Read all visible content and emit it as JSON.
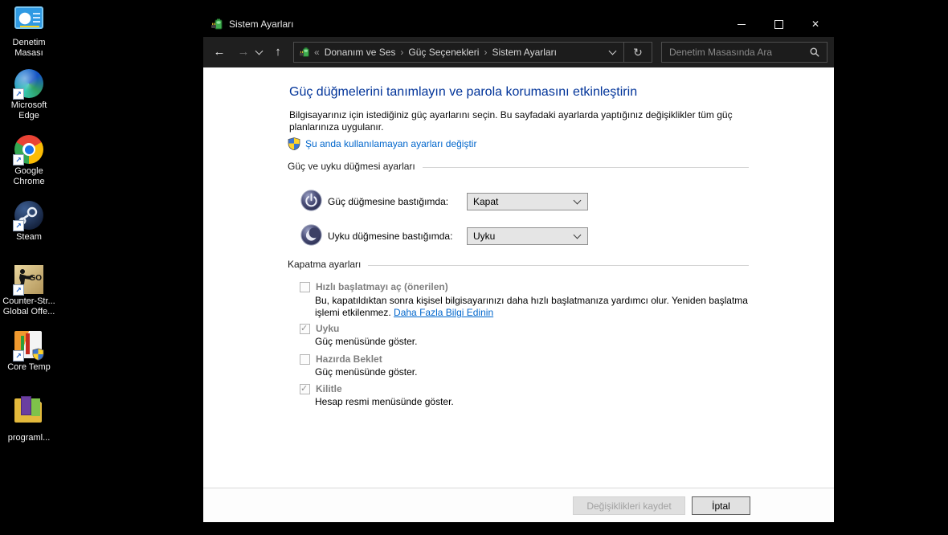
{
  "colors": {
    "heading_blue": "#003399",
    "link_blue": "#0066cc",
    "titlebar_bg": "#000000",
    "toolbar_bg": "#1f1f1f",
    "desktop_bg": "#000000"
  },
  "desktop": {
    "icons": [
      {
        "label": "Denetim Masası",
        "icon": "control-panel-icon"
      },
      {
        "label": "Microsoft Edge",
        "icon": "edge-icon"
      },
      {
        "label": "Google Chrome",
        "icon": "chrome-icon"
      },
      {
        "label": "Steam",
        "icon": "steam-icon"
      },
      {
        "label": "Counter-Str... Global Offe...",
        "icon": "csgo-icon",
        "icon_text": "GO"
      },
      {
        "label": "Core Temp",
        "icon": "core-temp-icon"
      },
      {
        "label": "programl...",
        "icon": "folder-icon"
      }
    ]
  },
  "titlebar": {
    "title": "Sistem Ayarları",
    "app_icon": "power-options-battery-icon",
    "close_glyph": "✕"
  },
  "toolbar": {
    "glyphs": {
      "back": "←",
      "forward": "→",
      "up": "↑",
      "refresh": "↻"
    },
    "breadcrumb": {
      "prefix": "«",
      "separator": "›",
      "items": [
        "Donanım ve Ses",
        "Güç Seçenekleri",
        "Sistem Ayarları"
      ]
    },
    "search": {
      "placeholder": "Denetim Masasında Ara",
      "icon": "magnifier-icon"
    }
  },
  "content": {
    "heading": "Güç düğmelerini tanımlayın ve parola korumasını etkinleştirin",
    "intro": "Bilgisayarınız için istediğiniz güç ayarlarını seçin. Bu sayfadaki ayarlarda yaptığınız değişiklikler tüm güç planlarınıza uygulanır.",
    "uac_link": "Şu anda kullanılamayan ayarları değiştir",
    "uac_icon": "uac-shield-icon",
    "power_section": {
      "title": "Güç ve uyku düğmesi ayarları",
      "rows": [
        {
          "icon": "power-button-icon",
          "label": "Güç düğmesine bastığımda:",
          "value": "Kapat"
        },
        {
          "icon": "sleep-button-icon",
          "label": "Uyku düğmesine bastığımda:",
          "value": "Uyku"
        }
      ]
    },
    "shutdown_section": {
      "title": "Kapatma ayarları",
      "items": [
        {
          "label": "Hızlı başlatmayı aç (önerilen)",
          "checked": false,
          "desc": "Bu, kapatıldıktan sonra kişisel bilgisayarınızı daha hızlı başlatmanıza yardımcı olur. Yeniden başlatma işlemi etkilenmez.",
          "link": "Daha Fazla Bilgi Edinin"
        },
        {
          "label": "Uyku",
          "checked": true,
          "desc": "Güç menüsünde göster."
        },
        {
          "label": "Hazırda Beklet",
          "checked": false,
          "desc": "Güç menüsünde göster."
        },
        {
          "label": "Kilitle",
          "checked": true,
          "desc": "Hesap resmi menüsünde göster."
        }
      ]
    }
  },
  "footer": {
    "save": "Değişiklikleri kaydet",
    "cancel": "İptal"
  }
}
